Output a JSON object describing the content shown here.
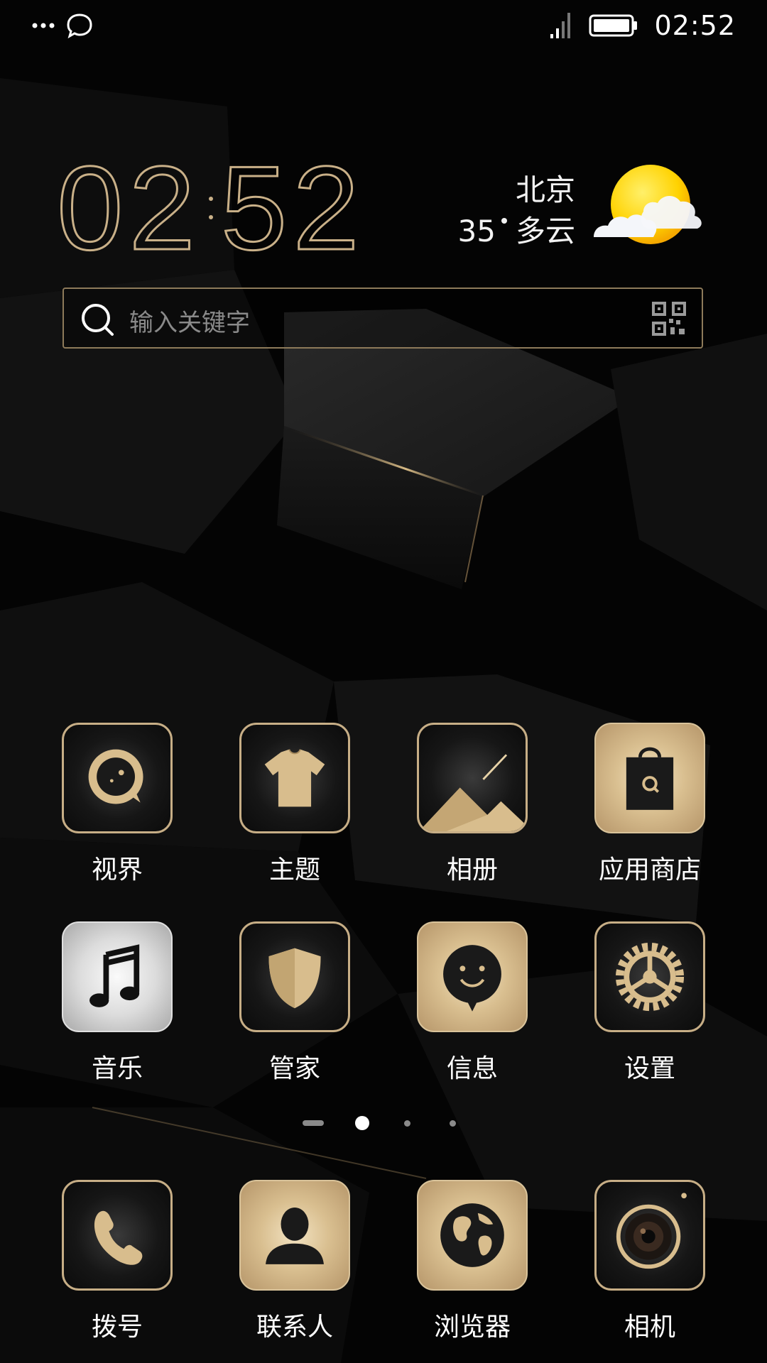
{
  "status_bar": {
    "time": "02:52",
    "left_icons": [
      "more-dots-icon",
      "chat-bubble-icon"
    ],
    "right_icons": [
      "signal-icon",
      "battery-icon"
    ]
  },
  "clock": {
    "hours": "02",
    "minutes": "52"
  },
  "weather": {
    "city": "北京",
    "temperature": "35",
    "condition": "多云",
    "icon": "partly-cloudy-icon"
  },
  "search": {
    "placeholder": "输入关键字",
    "icons": [
      "search-icon",
      "qr-code-icon"
    ]
  },
  "apps": {
    "row1": [
      {
        "label": "视界",
        "icon": "video-icon"
      },
      {
        "label": "主题",
        "icon": "tshirt-icon"
      },
      {
        "label": "相册",
        "icon": "mountain-icon"
      },
      {
        "label": "应用商店",
        "icon": "shopping-bag-icon"
      }
    ],
    "row2": [
      {
        "label": "音乐",
        "icon": "music-note-icon"
      },
      {
        "label": "管家",
        "icon": "shield-icon"
      },
      {
        "label": "信息",
        "icon": "message-bubble-icon"
      },
      {
        "label": "设置",
        "icon": "gear-icon"
      }
    ]
  },
  "page_indicator": {
    "pages": 4,
    "current": 2
  },
  "dock": [
    {
      "label": "拨号",
      "icon": "phone-icon"
    },
    {
      "label": "联系人",
      "icon": "contact-person-icon"
    },
    {
      "label": "浏览器",
      "icon": "globe-icon"
    },
    {
      "label": "相机",
      "icon": "camera-lens-icon"
    }
  ],
  "colors": {
    "accent_gold": "#c9b088",
    "background": "#050505"
  }
}
